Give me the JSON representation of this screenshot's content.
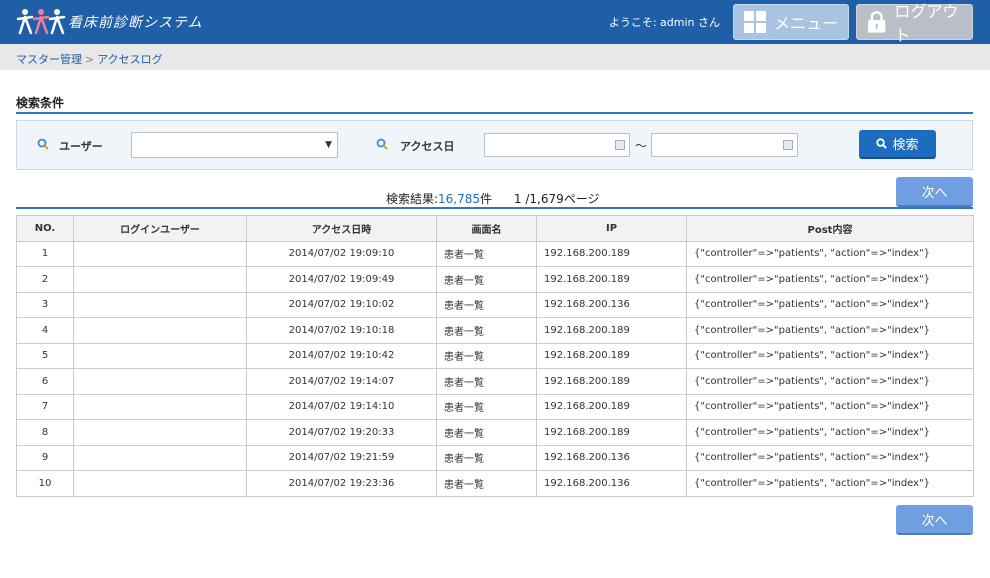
{
  "header": {
    "app_title": "看床前診断システム",
    "welcome": "ようこそ: admin さん",
    "menu_label": "メニュー",
    "logout_label": "ログアウト",
    "colors": {
      "bar": "#1e5fa8",
      "menu_button": "#a9c4e2",
      "logout_button": "#b9bfc6"
    }
  },
  "breadcrumb": {
    "items": [
      "マスター管理",
      "アクセスログ"
    ],
    "separator": ">"
  },
  "search": {
    "section_title": "検索条件",
    "user_label": "ユーザー",
    "user_value": "",
    "date_label": "アクセス日",
    "date_from": "",
    "date_to": "",
    "range_separator": "〜",
    "search_button": "検索"
  },
  "results": {
    "label": "検索結果:",
    "count": "16,785",
    "count_unit": "件",
    "page_info": "1 /1,679ページ",
    "next_label": "次へ"
  },
  "table": {
    "headers": [
      "NO.",
      "ログインユーザー",
      "アクセス日時",
      "画面名",
      "IP",
      "Post内容"
    ],
    "rows": [
      [
        "1",
        "",
        "2014/07/02 19:09:10",
        "患者一覧",
        "192.168.200.189",
        "{\"controller\"=>\"patients\", \"action\"=>\"index\"}"
      ],
      [
        "2",
        "",
        "2014/07/02 19:09:49",
        "患者一覧",
        "192.168.200.189",
        "{\"controller\"=>\"patients\", \"action\"=>\"index\"}"
      ],
      [
        "3",
        "",
        "2014/07/02 19:10:02",
        "患者一覧",
        "192.168.200.136",
        "{\"controller\"=>\"patients\", \"action\"=>\"index\"}"
      ],
      [
        "4",
        "",
        "2014/07/02 19:10:18",
        "患者一覧",
        "192.168.200.189",
        "{\"controller\"=>\"patients\", \"action\"=>\"index\"}"
      ],
      [
        "5",
        "",
        "2014/07/02 19:10:42",
        "患者一覧",
        "192.168.200.189",
        "{\"controller\"=>\"patients\", \"action\"=>\"index\"}"
      ],
      [
        "6",
        "",
        "2014/07/02 19:14:07",
        "患者一覧",
        "192.168.200.189",
        "{\"controller\"=>\"patients\", \"action\"=>\"index\"}"
      ],
      [
        "7",
        "",
        "2014/07/02 19:14:10",
        "患者一覧",
        "192.168.200.189",
        "{\"controller\"=>\"patients\", \"action\"=>\"index\"}"
      ],
      [
        "8",
        "",
        "2014/07/02 19:20:33",
        "患者一覧",
        "192.168.200.189",
        "{\"controller\"=>\"patients\", \"action\"=>\"index\"}"
      ],
      [
        "9",
        "",
        "2014/07/02 19:21:59",
        "患者一覧",
        "192.168.200.136",
        "{\"controller\"=>\"patients\", \"action\"=>\"index\"}"
      ],
      [
        "10",
        "",
        "2014/07/02 19:23:36",
        "患者一覧",
        "192.168.200.136",
        "{\"controller\"=>\"patients\", \"action\"=>\"index\"}"
      ]
    ]
  }
}
